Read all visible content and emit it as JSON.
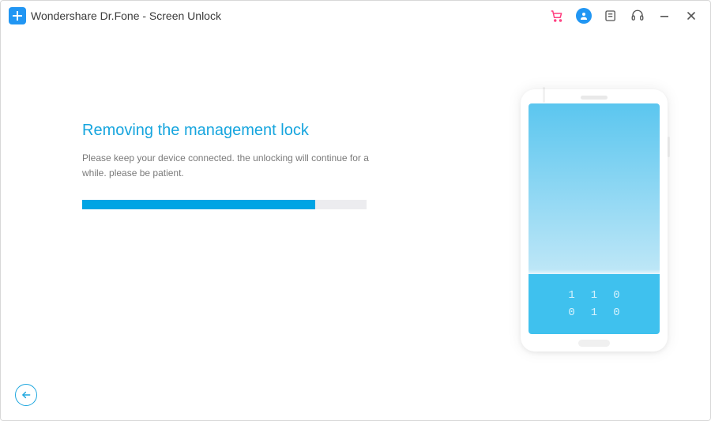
{
  "titlebar": {
    "app_title": "Wondershare Dr.Fone - Screen Unlock"
  },
  "main": {
    "heading": "Removing the management lock",
    "subtext": "Please keep your device connected. the unlocking will continue for a while. please be patient.",
    "progress_percent": 82
  },
  "phone": {
    "digits_row1": "110",
    "digits_row2": "010"
  },
  "colors": {
    "accent": "#00a4e4",
    "heading": "#16a5de"
  }
}
